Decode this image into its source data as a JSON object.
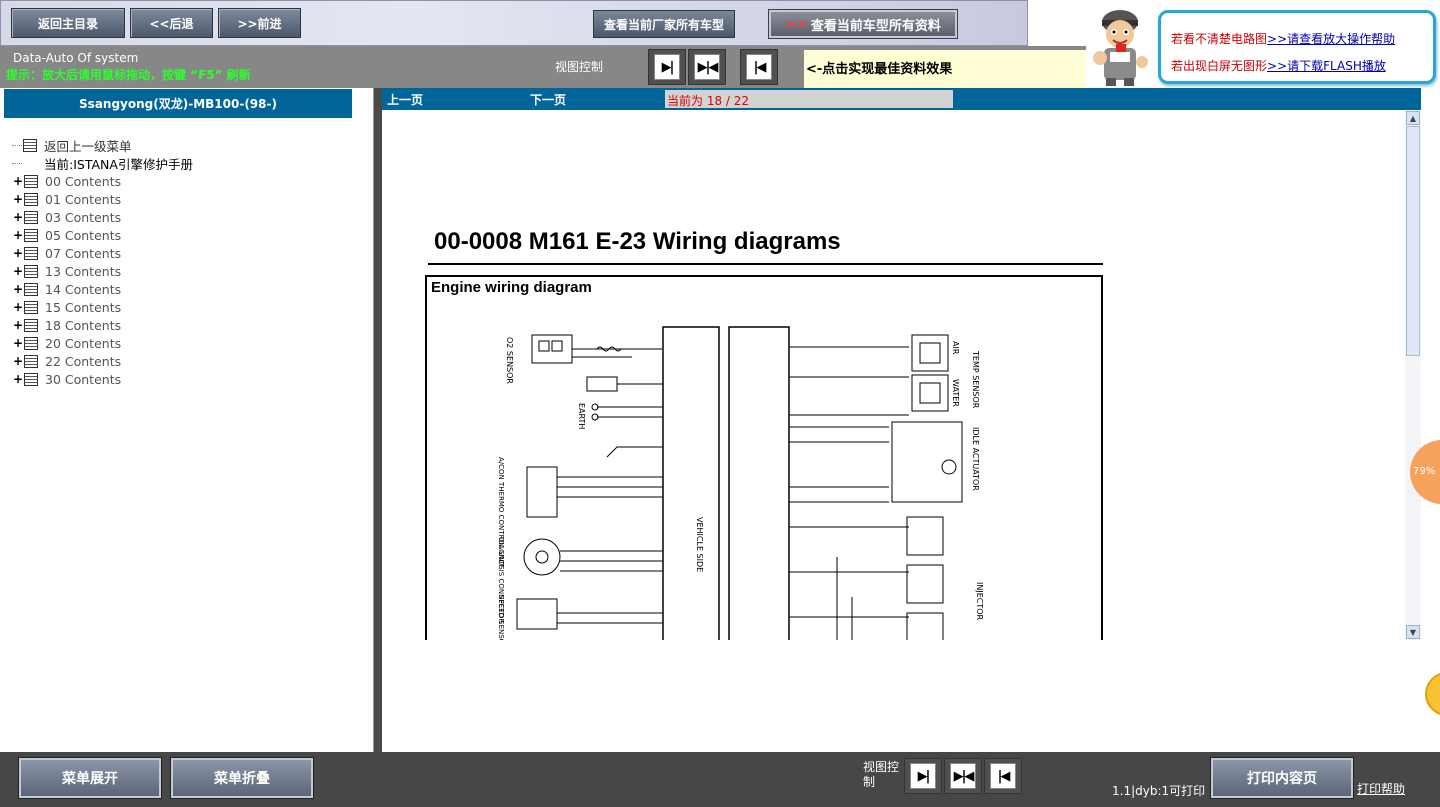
{
  "top_nav": {
    "main_menu": "返回主目录",
    "back": "<<后退",
    "forward": ">>前进",
    "view_maker_models": "查看当前厂家所有车型",
    "view_model_all_arrow": ">>",
    "view_model_all": "查看当前车型所有资料"
  },
  "help_box": {
    "line1_prefix": "若看不清楚电路图",
    "line1_link": ">>请查看放大操作帮助",
    "line2_prefix": "若出现白屏无图形",
    "line2_link": ">>请下载FLASH播放"
  },
  "status_bar": {
    "system_name": "Data-Auto Of system",
    "warning": "提示：放大后请用鼠标拖动，按键 “F5” 刷新",
    "view_control_label": "视图控制",
    "tip": "<-点击实现最佳资料效果"
  },
  "sidebar": {
    "title": "Ssangyong(双龙)-MB100-(98-)",
    "back_item": "返回上一级菜单",
    "current_item": "当前:ISTANA引擎修护手册",
    "items": [
      {
        "label": "00 Contents"
      },
      {
        "label": "01 Contents"
      },
      {
        "label": "03 Contents"
      },
      {
        "label": "05 Contents"
      },
      {
        "label": "07 Contents"
      },
      {
        "label": "13 Contents"
      },
      {
        "label": "14 Contents"
      },
      {
        "label": "15 Contents"
      },
      {
        "label": "18 Contents"
      },
      {
        "label": "20 Contents"
      },
      {
        "label": "22 Contents"
      },
      {
        "label": "30 Contents"
      }
    ],
    "expand_symbol": "+"
  },
  "pager": {
    "prev": "上一页",
    "next": "下一页",
    "current": "当前为  18 / 22"
  },
  "document": {
    "title": "00-0008 M161 E-23 Wiring diagrams",
    "subtitle": "Engine wiring diagram",
    "labels": {
      "o2": "O2 SENSOR",
      "earth": "EARTH",
      "thermo": "A/CON THERMO CONTROL UNIT",
      "diag": "DIAGNOSIS CONNECTOR",
      "speed": "SPEED SENSOR",
      "vehicle": "VEHICLE SIDE",
      "air": "AIR",
      "temp": "TEMP SENSOR",
      "water": "WATER",
      "idle": "IDLE ACTUATOR",
      "injector": "INJECTOR"
    }
  },
  "side_badge": {
    "percent": "79%"
  },
  "bottom_bar": {
    "expand_menu": "菜单展开",
    "collapse_menu": "菜单折叠",
    "view_control_label": "视图控制",
    "version": "1.1|dyb:1可打印",
    "print_content": "打印内容页",
    "print_help": "打印帮助"
  }
}
